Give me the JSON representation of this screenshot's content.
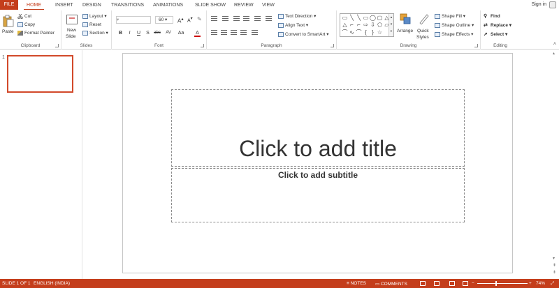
{
  "tabs": [
    "FILE",
    "HOME",
    "INSERT",
    "DESIGN",
    "TRANSITIONS",
    "ANIMATIONS",
    "SLIDE SHOW",
    "REVIEW",
    "VIEW"
  ],
  "account": {
    "signin": "Sign in"
  },
  "clipboard": {
    "label": "Clipboard",
    "paste": "Paste",
    "cut": "Cut",
    "copy": "Copy",
    "format_painter": "Format Painter"
  },
  "slides_group": {
    "label": "Slides",
    "new_slide_1": "New",
    "new_slide_2": "Slide",
    "layout": "Layout",
    "reset": "Reset",
    "section": "Section"
  },
  "font_group": {
    "label": "Font",
    "font_size": "60",
    "bold": "B",
    "italic": "I",
    "underline": "U",
    "shadow": "S",
    "strike": "abc",
    "spacing": "AV",
    "change_case": "Aa",
    "color": "A"
  },
  "paragraph_group": {
    "label": "Paragraph",
    "text_direction": "Text Direction",
    "align_text": "Align Text",
    "convert_smartart": "Convert to SmartArt"
  },
  "drawing_group": {
    "label": "Drawing",
    "arrange": "Arrange",
    "quick_styles_1": "Quick",
    "quick_styles_2": "Styles",
    "shape_fill": "Shape Fill",
    "shape_outline": "Shape Outline",
    "shape_effects": "Shape Effects"
  },
  "editing_group": {
    "label": "Editing",
    "find": "Find",
    "replace": "Replace",
    "select": "Select"
  },
  "thumbnails": {
    "slide_number": "1"
  },
  "slide": {
    "title_placeholder": "Click to add title",
    "subtitle_placeholder": "Click to add subtitle"
  },
  "status": {
    "slide_info": "SLIDE 1 OF 1",
    "language": "ENGLISH (INDIA)",
    "notes": "NOTES",
    "comments": "COMMENTS",
    "zoom": "74%",
    "zoom_level": 0.74
  },
  "colors": {
    "accent": "#c43e1c",
    "thumb_border": "#d2492a"
  }
}
